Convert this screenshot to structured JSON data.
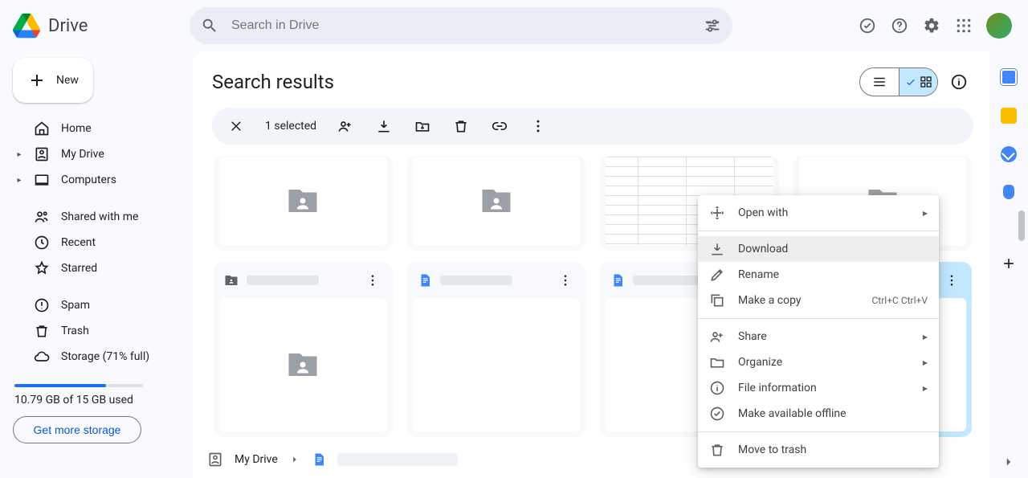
{
  "product": "Drive",
  "search": {
    "placeholder": "Search in Drive"
  },
  "new_button": "New",
  "nav": {
    "home": "Home",
    "mydrive": "My Drive",
    "computers": "Computers",
    "shared": "Shared with me",
    "recent": "Recent",
    "starred": "Starred",
    "spam": "Spam",
    "trash": "Trash",
    "storage": "Storage (71% full)"
  },
  "storage": {
    "percent": 71,
    "used_text": "10.79 GB of 15 GB used",
    "cta": "Get more storage"
  },
  "page_title": "Search results",
  "selection": {
    "count_label": "1 selected"
  },
  "breadcrumb": {
    "root": "My Drive"
  },
  "context_menu": {
    "open_with": "Open with",
    "download": "Download",
    "rename": "Rename",
    "make_copy": "Make a copy",
    "make_copy_shortcut": "Ctrl+C Ctrl+V",
    "share": "Share",
    "organize": "Organize",
    "file_info": "File information",
    "offline": "Make available offline",
    "trash": "Move to trash"
  }
}
